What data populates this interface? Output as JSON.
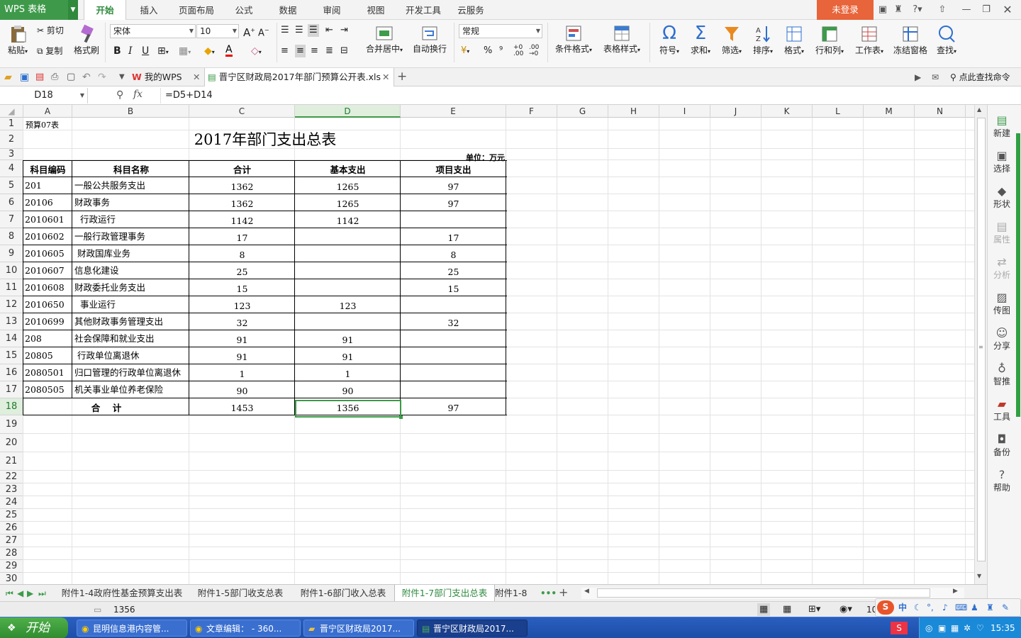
{
  "app": {
    "logo": "WPS 表格",
    "login": "未登录"
  },
  "menu": [
    "开始",
    "插入",
    "页面布局",
    "公式",
    "数据",
    "审阅",
    "视图",
    "开发工具",
    "云服务"
  ],
  "ribbon": {
    "paste": "粘贴",
    "cut": "剪切",
    "copy": "复制",
    "format_painter": "格式刷",
    "font_name": "宋体",
    "font_size": "10",
    "merge_center": "合并居中",
    "wrap_text": "自动换行",
    "number_format": "常规",
    "cond_format": "条件格式",
    "table_style": "表格样式",
    "symbol": "符号",
    "sum": "求和",
    "filter": "筛选",
    "sort": "排序",
    "format": "格式",
    "row_col": "行和列",
    "worksheet": "工作表",
    "freeze": "冻结窗格",
    "find": "查找"
  },
  "doc_tabs": [
    {
      "label": "我的WPS"
    },
    {
      "label": "晋宁区财政局2017年部门预算公开表.xls"
    }
  ],
  "quick_search": "点此查找命令",
  "formula_bar": {
    "cell_ref": "D18",
    "fx": "fx",
    "formula": "=D5+D14"
  },
  "columns": [
    "A",
    "B",
    "C",
    "D",
    "E",
    "F",
    "G",
    "H",
    "I",
    "J",
    "K",
    "L",
    "M",
    "N"
  ],
  "rows": [
    "1",
    "2",
    "3",
    "4",
    "5",
    "6",
    "7",
    "8",
    "9",
    "10",
    "11",
    "12",
    "13",
    "14",
    "15",
    "16",
    "17",
    "18",
    "19",
    "20",
    "21",
    "22",
    "23",
    "24",
    "25",
    "26",
    "27",
    "28",
    "29",
    "30"
  ],
  "sheet": {
    "a1": "预算07表",
    "title": "2017年部门支出总表",
    "unit": "单位：万元",
    "headers": [
      "科目编码",
      "科目名称",
      "合计",
      "基本支出",
      "项目支出"
    ],
    "data": [
      [
        "201",
        "一般公共服务支出",
        "1362",
        "1265",
        "97"
      ],
      [
        "20106",
        "财政事务",
        "1362",
        "1265",
        "97"
      ],
      [
        "2010601",
        "  行政运行",
        "1142",
        "1142",
        ""
      ],
      [
        "2010602",
        "一般行政管理事务",
        "17",
        "",
        "17"
      ],
      [
        "2010605",
        " 财政国库业务",
        "8",
        "",
        "8"
      ],
      [
        "2010607",
        "信息化建设",
        "25",
        "",
        "25"
      ],
      [
        "2010608",
        "财政委托业务支出",
        "15",
        "",
        "15"
      ],
      [
        "2010650",
        "  事业运行",
        "123",
        "123",
        ""
      ],
      [
        "2010699",
        "其他财政事务管理支出",
        "32",
        "",
        "32"
      ],
      [
        "208",
        "社会保障和就业支出",
        "91",
        "91",
        ""
      ],
      [
        "20805",
        " 行政单位离退休",
        "91",
        "91",
        ""
      ],
      [
        "2080501",
        "归口管理的行政单位离退休",
        "1",
        "1",
        ""
      ],
      [
        "2080505",
        "机关事业单位养老保险",
        "90",
        "90",
        ""
      ]
    ],
    "total": {
      "label": "合    计",
      "c": "1453",
      "d": "1356",
      "e": "97"
    }
  },
  "sheet_tabs": [
    "附件1-4政府性基金预算支出表",
    "附件1-5部门收支总表",
    "附件1-6部门收入总表",
    "附件1-7部门支出总表",
    "附件1-8"
  ],
  "status": {
    "value": "1356",
    "zoom": "10"
  },
  "right_panel": [
    "新建",
    "选择",
    "形状",
    "属性",
    "分析",
    "传图",
    "分享",
    "智推",
    "工具",
    "备份",
    "帮助"
  ],
  "taskbar": {
    "start": "开始",
    "tasks": [
      "昆明信息港内容管...",
      "文章编辑： - 360...",
      "晋宁区财政局2017...",
      "晋宁区财政局2017..."
    ],
    "ime": "中",
    "clock": "15:35"
  }
}
